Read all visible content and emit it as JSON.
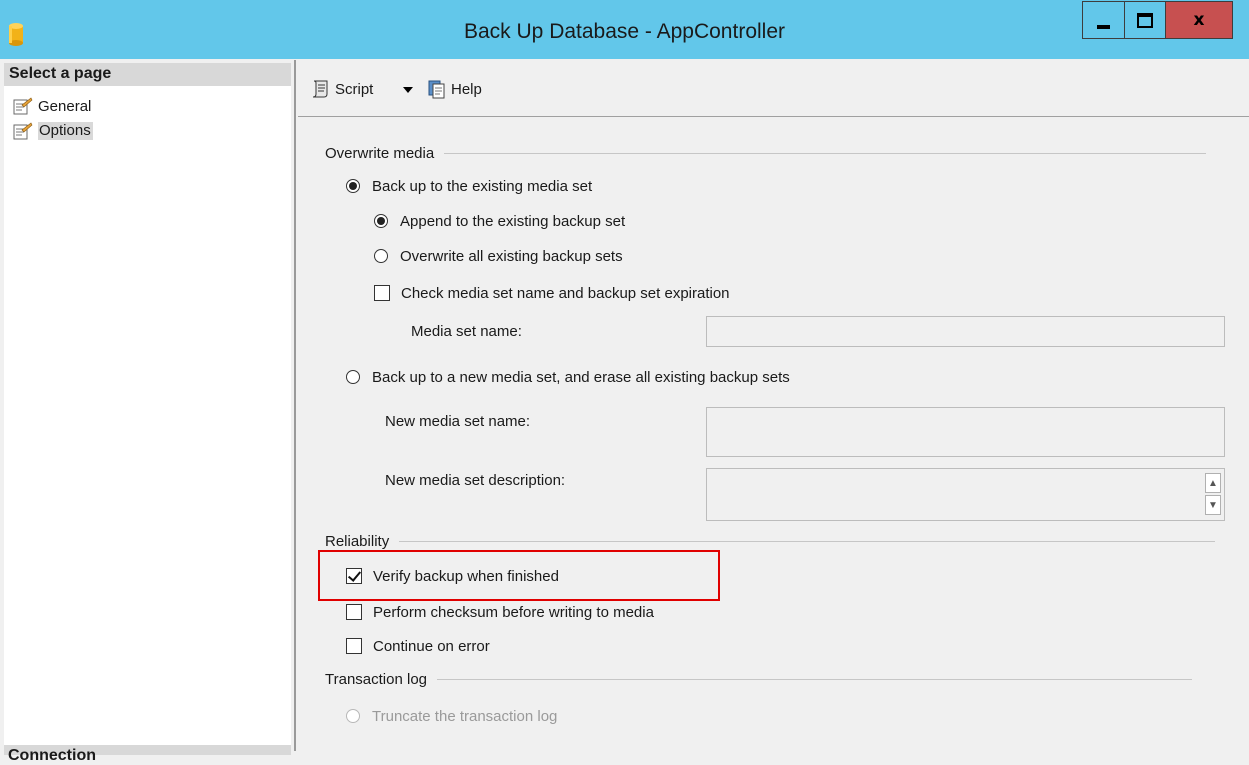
{
  "window": {
    "title": "Back Up Database - AppController",
    "min_icon": "minimize-icon",
    "max_icon": "maximize-icon",
    "close_label": "x",
    "accent": "#62c7ea",
    "close_color": "#c75050"
  },
  "left_pane": {
    "header": "Select a page",
    "pages": [
      {
        "label": "General",
        "icon": "page-icon",
        "selected": false
      },
      {
        "label": "Options",
        "icon": "page-icon",
        "selected": true
      }
    ],
    "bottom_header": "Connection"
  },
  "toolbar": {
    "script_label": "Script",
    "help_label": "Help"
  },
  "overwrite_media": {
    "header": "Overwrite media",
    "backup_existing": "Back up to the existing media set",
    "append": "Append to the existing backup set",
    "overwrite_all": "Overwrite all existing backup sets",
    "check_media": "Check media set name and backup set expiration",
    "media_set_name_label": "Media set name:",
    "media_set_name_value": "",
    "backup_new": "Back up to a new media set, and erase all existing backup sets",
    "new_media_set_name_label": "New media set name:",
    "new_media_set_desc_label": "New media set description:"
  },
  "reliability": {
    "header": "Reliability",
    "verify": "Verify backup when finished",
    "checksum": "Perform checksum before writing to media",
    "continue_error": "Continue on error"
  },
  "transaction_log": {
    "header": "Transaction log",
    "truncate": "Truncate the transaction log"
  },
  "highlight_color": "#e00000"
}
